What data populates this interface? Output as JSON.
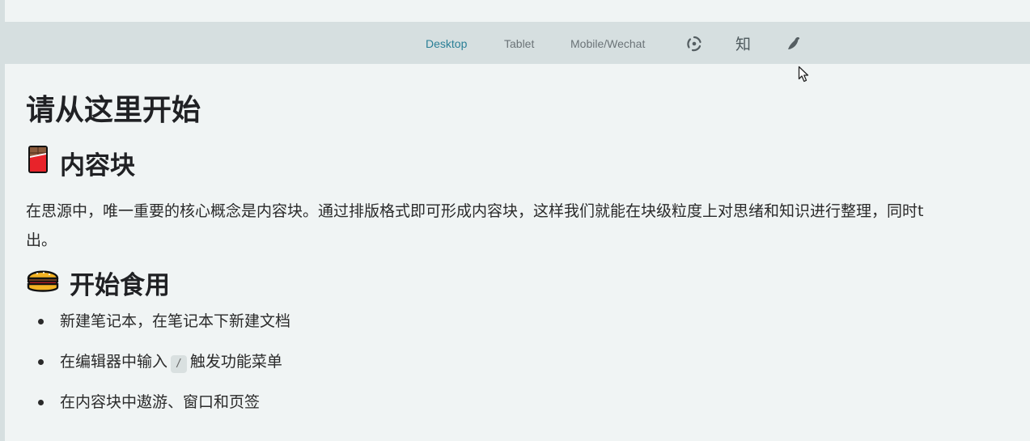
{
  "toolbar": {
    "tabs": [
      {
        "label": "Desktop",
        "active": true
      },
      {
        "label": "Tablet",
        "active": false
      },
      {
        "label": "Mobile/Wechat",
        "active": false
      }
    ],
    "icons": [
      "refresh-icon",
      "zhihu-icon",
      "yuque-bird-icon"
    ],
    "zhihu_glyph": "知",
    "accent_color": "#2a7f96"
  },
  "doc": {
    "title": "请从这里开始",
    "section1": {
      "emoji": "chocolate-bar-icon",
      "heading": "内容块",
      "paragraph_line1": "在思源中，唯一重要的核心概念是内容块。通过排版格式即可形成内容块，这样我们就能在块级粒度上对思绪和知识进行整理，同时t",
      "paragraph_line2": "出。"
    },
    "section2": {
      "emoji": "burger-icon",
      "heading": "开始食用",
      "items": [
        {
          "text": "新建笔记本，在笔记本下新建文档"
        },
        {
          "before": "在编辑器中输入",
          "code": "/",
          "after": "触发功能菜单"
        },
        {
          "text": "在内容块中遨游、窗口和页签"
        }
      ]
    }
  }
}
